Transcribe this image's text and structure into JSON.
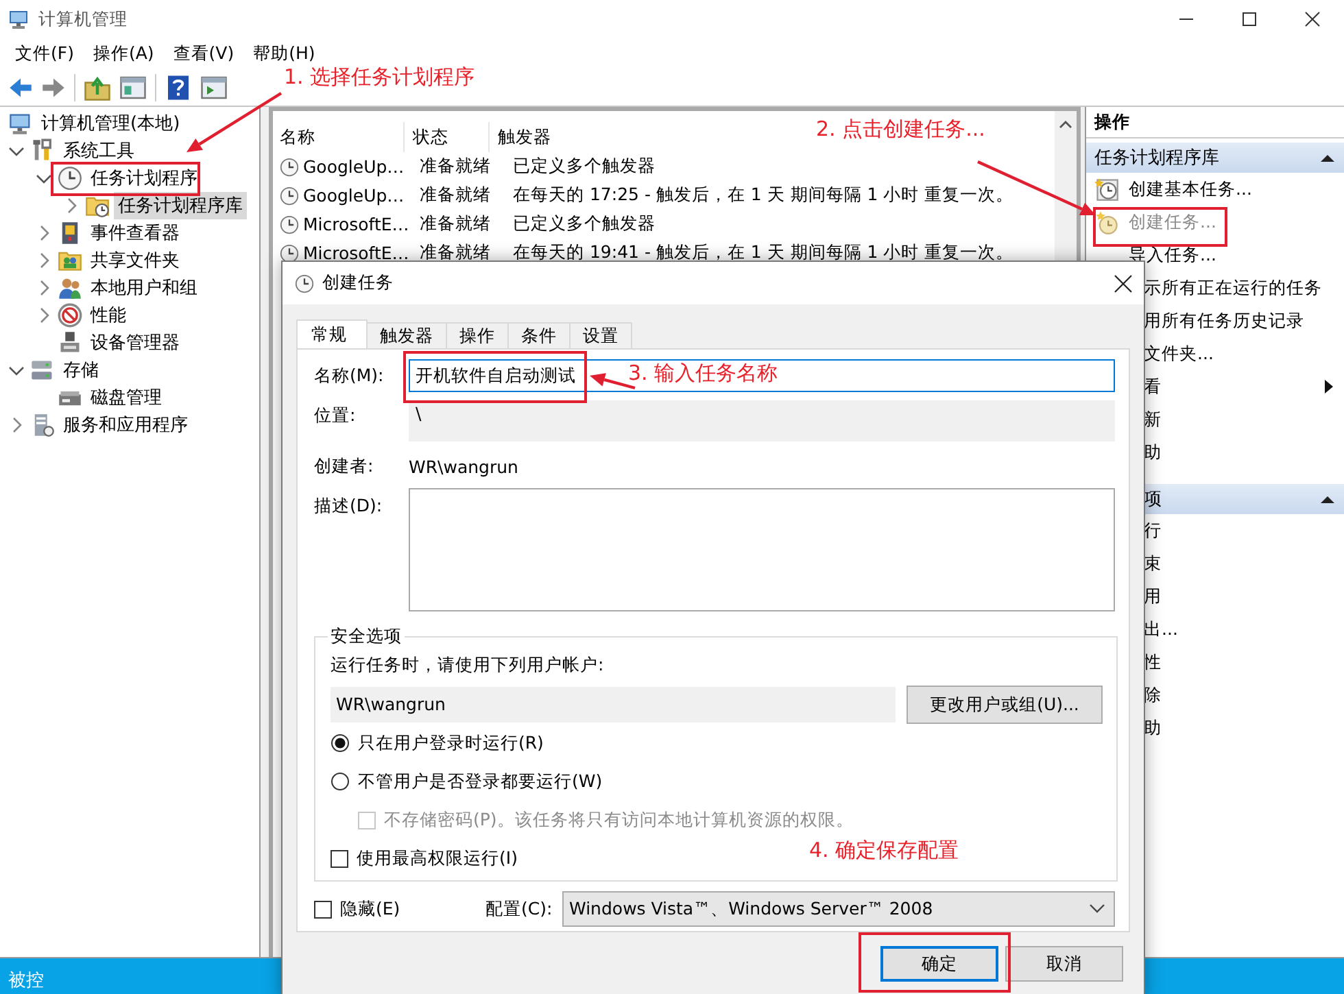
{
  "window": {
    "title": "计算机管理"
  },
  "menu": [
    "文件(F)",
    "操作(A)",
    "查看(V)",
    "帮助(H)"
  ],
  "tree": [
    {
      "label": "计算机管理(本地)",
      "selected": false,
      "children": [
        {
          "label": "系统工具",
          "expanded": true,
          "selected": false,
          "children": [
            {
              "label": "任务计划程序",
              "expanded": true,
              "selected": false,
              "children": [
                {
                  "label": "任务计划程序库",
                  "expanded": false,
                  "selected": true
                }
              ]
            },
            {
              "label": "事件查看器",
              "expanded": false,
              "selected": false
            },
            {
              "label": "共享文件夹",
              "expanded": false,
              "selected": false
            },
            {
              "label": "本地用户和组",
              "expanded": false,
              "selected": false
            },
            {
              "label": "性能",
              "expanded": false,
              "selected": false
            },
            {
              "label": "设备管理器",
              "selected": false
            }
          ]
        },
        {
          "label": "存储",
          "expanded": true,
          "selected": false,
          "children": [
            {
              "label": "磁盘管理",
              "selected": false
            }
          ]
        },
        {
          "label": "服务和应用程序",
          "expanded": false,
          "selected": false
        }
      ]
    }
  ],
  "task_table": {
    "columns": [
      "名称",
      "状态",
      "触发器"
    ],
    "rows": [
      [
        "GoogleUp…",
        "准备就绪",
        "已定义多个触发器"
      ],
      [
        "GoogleUp…",
        "准备就绪",
        "在每天的 17:25 - 触发后，在 1 天 期间每隔 1 小时 重复一次。"
      ],
      [
        "MicrosoftE…",
        "准备就绪",
        "已定义多个触发器"
      ],
      [
        "MicrosoftE…",
        "准备就绪",
        "在每天的 19:41 - 触发后，在 1 天 期间每隔 1 小时 重复一次。"
      ]
    ]
  },
  "actions": {
    "title": "操作",
    "sections": [
      {
        "title": "任务计划程序库",
        "expanded": true,
        "items": [
          {
            "label": "创建基本任务...",
            "disabled": false,
            "submenu": false
          },
          {
            "label": "创建任务...",
            "disabled": true,
            "submenu": false
          },
          {
            "label": "导入任务...",
            "disabled": false,
            "submenu": false
          },
          {
            "label": "示所有正在运行的任务",
            "disabled": false,
            "submenu": false
          },
          {
            "label": "用所有任务历史记录",
            "disabled": false,
            "submenu": false
          },
          {
            "label": "文件夹...",
            "disabled": false,
            "submenu": false
          },
          {
            "label": "看",
            "disabled": false,
            "submenu": true
          },
          {
            "label": "新",
            "disabled": false,
            "submenu": false
          },
          {
            "label": "助",
            "disabled": false,
            "submenu": false
          }
        ]
      },
      {
        "title": "项",
        "expanded": true,
        "items": [
          {
            "label": "行",
            "disabled": false,
            "submenu": false
          },
          {
            "label": "束",
            "disabled": false,
            "submenu": false
          },
          {
            "label": "用",
            "disabled": false,
            "submenu": false
          },
          {
            "label": "出...",
            "disabled": false,
            "submenu": false
          },
          {
            "label": "性",
            "disabled": false,
            "submenu": false
          },
          {
            "label": "除",
            "disabled": false,
            "submenu": false
          },
          {
            "label": "助",
            "disabled": false,
            "submenu": false
          }
        ]
      }
    ]
  },
  "dialog": {
    "title": "创建任务",
    "tabs": [
      {
        "label": "常规",
        "selected": true
      },
      {
        "label": "触发器",
        "selected": false
      },
      {
        "label": "操作",
        "selected": false
      },
      {
        "label": "条件",
        "selected": false
      },
      {
        "label": "设置",
        "selected": false
      }
    ],
    "name": {
      "label": "名称(M):",
      "value": "开机软件自启动测试"
    },
    "location": {
      "label": "位置:",
      "value": "\\"
    },
    "author": {
      "label": "创建者:",
      "value": "WR\\wangrun"
    },
    "description": {
      "label": "描述(D):"
    },
    "security": {
      "title": "安全选项",
      "prompt": "运行任务时，请使用下列用户帐户:",
      "account": "WR\\wangrun",
      "change_button": "更改用户或组(U)...",
      "options": [
        {
          "kind": "radio",
          "label": "只在用户登录时运行(R)",
          "selected": true,
          "disabled": false
        },
        {
          "kind": "radio",
          "label": "不管用户是否登录都要运行(W)",
          "selected": false,
          "disabled": false,
          "children": [
            {
              "kind": "checkbox",
              "label": "不存储密码(P)。该任务将只有访问本地计算机资源的权限。",
              "checked": false,
              "disabled": true
            }
          ]
        },
        {
          "kind": "checkbox",
          "label": "使用最高权限运行(I)",
          "checked": false,
          "disabled": false
        }
      ]
    },
    "hidden": {
      "label": "隐藏(E)",
      "checked": false
    },
    "config": {
      "label": "配置(C):",
      "value": "Windows Vista™、Windows Server™ 2008"
    },
    "buttons": [
      {
        "label": "确定",
        "default": true
      },
      {
        "label": "取消",
        "default": false
      }
    ]
  },
  "annotations": [
    {
      "text": "1. 选择任务计划程序"
    },
    {
      "text": "2. 点击创建任务..."
    },
    {
      "text": "3. 输入任务名称"
    },
    {
      "text": "4. 确定保存配置"
    }
  ],
  "desktop": {
    "icon_label": "被控"
  }
}
